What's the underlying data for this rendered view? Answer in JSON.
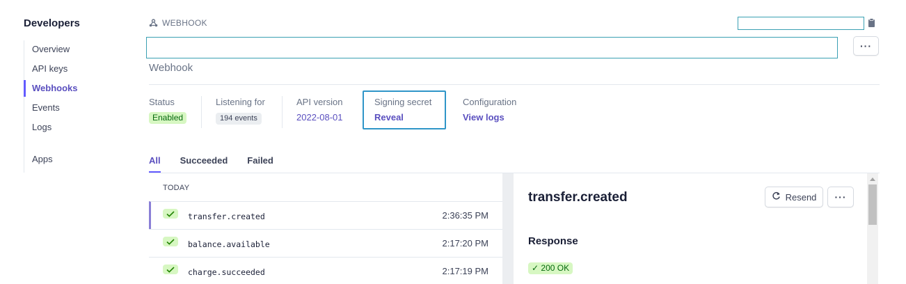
{
  "sidebar": {
    "title": "Developers",
    "items": [
      {
        "label": "Overview"
      },
      {
        "label": "API keys"
      },
      {
        "label": "Webhooks",
        "active": true
      },
      {
        "label": "Events"
      },
      {
        "label": "Logs"
      },
      {
        "label": "Apps"
      }
    ]
  },
  "header": {
    "breadcrumb": "WEBHOOK",
    "endpoint_url": "",
    "subtitle": "Webhook",
    "more_label": "···"
  },
  "meta": {
    "status": {
      "label": "Status",
      "value": "Enabled"
    },
    "listening": {
      "label": "Listening for",
      "value": "194 events"
    },
    "api_version": {
      "label": "API version",
      "value": "2022-08-01"
    },
    "signing_secret": {
      "label": "Signing secret",
      "value": "Reveal"
    },
    "configuration": {
      "label": "Configuration",
      "value": "View logs"
    }
  },
  "tabs": [
    {
      "label": "All",
      "active": true
    },
    {
      "label": "Succeeded"
    },
    {
      "label": "Failed"
    }
  ],
  "events": {
    "group_label": "TODAY",
    "rows": [
      {
        "name": "transfer.created",
        "time": "2:36:35 PM",
        "selected": true
      },
      {
        "name": "balance.available",
        "time": "2:17:20 PM"
      },
      {
        "name": "charge.succeeded",
        "time": "2:17:19 PM"
      }
    ]
  },
  "detail": {
    "title": "transfer.created",
    "resend_label": "Resend",
    "more_label": "···",
    "response_label": "Response",
    "status_code": "✓ 200 OK"
  },
  "colors": {
    "accent": "#635bff",
    "success_bg": "#d7f7c2",
    "success_text": "#05690d",
    "focus_ring": "#2f95c8"
  }
}
